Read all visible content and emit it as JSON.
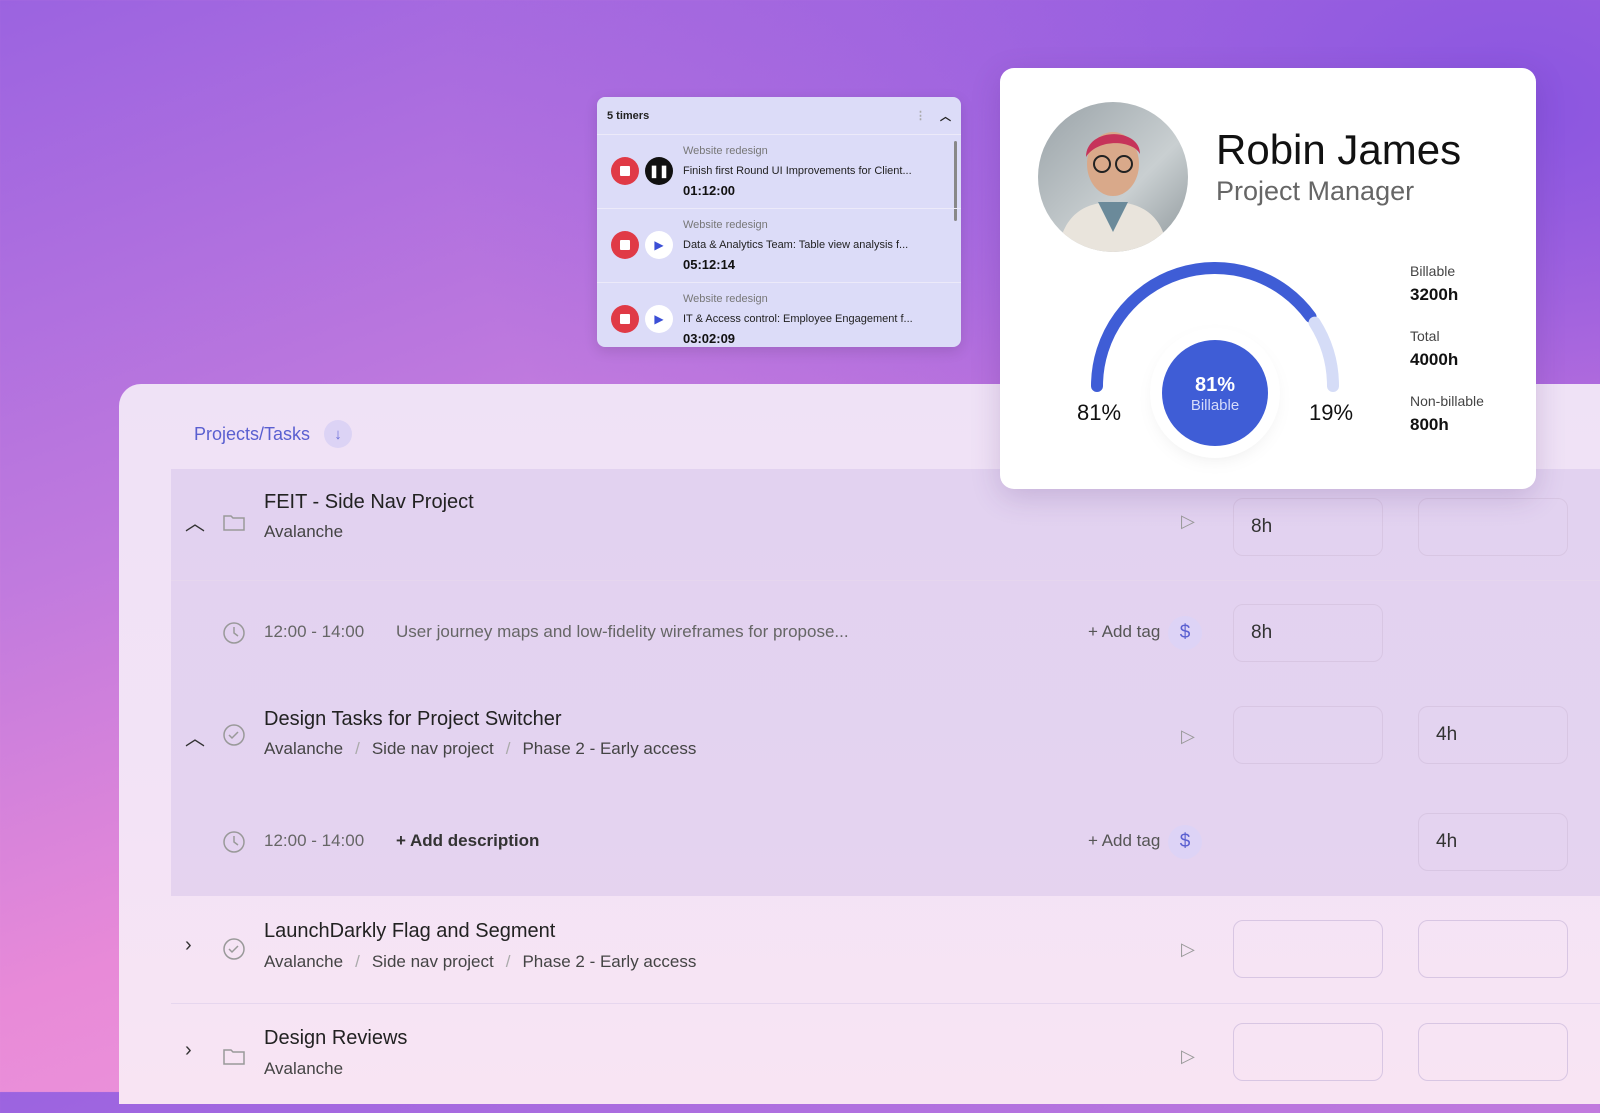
{
  "timers": {
    "title": "5 timers",
    "items": [
      {
        "project": "Website redesign",
        "task": "Finish first Round UI Improvements for Client...",
        "duration": "01:12:00",
        "state": "running"
      },
      {
        "project": "Website redesign",
        "task": "Data & Analytics Team: Table view analysis f...",
        "duration": "05:12:14",
        "state": "paused"
      },
      {
        "project": "Website redesign",
        "task": "IT & Access control: Employee Engagement f...",
        "duration": "03:02:09",
        "state": "paused"
      }
    ]
  },
  "profile": {
    "name": "Robin James",
    "role": "Project Manager",
    "billable_pct": 81,
    "nonbillable_pct": 19,
    "left_label": "81%",
    "right_label": "19%",
    "center_value": "81%",
    "center_label": "Billable",
    "stats": [
      {
        "label": "Billable",
        "value": "3200h"
      },
      {
        "label": "Total",
        "value": "4000h"
      },
      {
        "label": "Non-billable",
        "value": "800h"
      }
    ],
    "colors": {
      "billable": "#3f5dd6",
      "nonbillable": "#d5dcf7"
    }
  },
  "list": {
    "header": "Projects/Tasks",
    "rows": [
      {
        "title": "FEIT - Side Nav Project",
        "path": [
          "Avalanche"
        ],
        "col1": "8h",
        "col2": ""
      },
      {
        "time": "12:00 - 14:00",
        "desc": "User journey maps and low-fidelity wireframes for propose...",
        "add_tag": "+ Add tag",
        "col1": "8h"
      },
      {
        "title": "Design Tasks for Project Switcher",
        "path": [
          "Avalanche",
          "Side nav project",
          "Phase 2 - Early access"
        ],
        "col1": "",
        "col2": "4h"
      },
      {
        "time": "12:00 - 14:00",
        "add_desc": "+ Add description",
        "add_tag": "+ Add tag",
        "col2": "4h"
      },
      {
        "title": "LaunchDarkly Flag and Segment",
        "path": [
          "Avalanche",
          "Side nav project",
          "Phase 2 - Early access"
        ],
        "col1": "",
        "col2": ""
      },
      {
        "title": "Design Reviews",
        "path": [
          "Avalanche"
        ],
        "col1": "",
        "col2": ""
      }
    ]
  }
}
